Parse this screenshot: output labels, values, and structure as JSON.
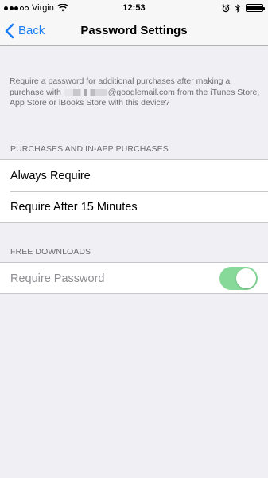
{
  "status_bar": {
    "carrier": "Virgin",
    "time": "12:53",
    "signal_bars_filled": 3,
    "signal_bars_total": 5,
    "icons": [
      "wifi-icon",
      "alarm-icon",
      "bluetooth-icon",
      "battery-icon"
    ]
  },
  "nav": {
    "back_label": "Back",
    "title": "Password Settings"
  },
  "description": {
    "text_before_email": "Require a password for additional purchases after making a purchase with ",
    "email_visible": "@googlemail.com",
    "text_after_email": " from the iTunes Store, App Store or iBooks Store with this device?"
  },
  "sections": {
    "purchases": {
      "header": "PURCHASES AND IN-APP PURCHASES",
      "options": [
        "Always Require",
        "Require After 15 Minutes"
      ]
    },
    "free_downloads": {
      "header": "FREE DOWNLOADS",
      "toggle_label": "Require Password",
      "toggle_on": true,
      "toggle_enabled": false
    }
  },
  "colors": {
    "accent": "#1a7cf5",
    "toggle_on": "#86d998",
    "background": "#efeff4",
    "secondary_text": "#6d6d72"
  }
}
